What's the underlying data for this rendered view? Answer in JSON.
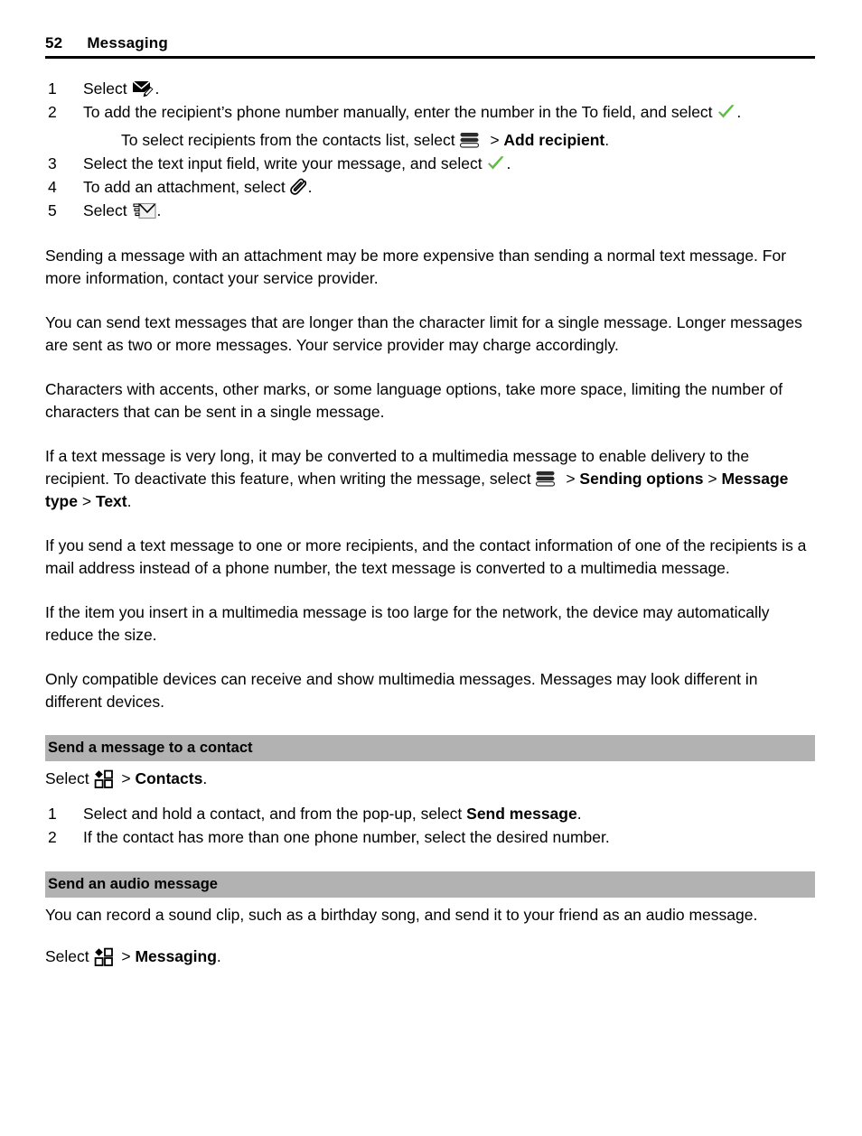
{
  "header": {
    "page_number": "52",
    "chapter": "Messaging"
  },
  "icons": {
    "new_message": "new-message-envelope-pencil-icon",
    "check": "green-check-icon",
    "menu": "options-menu-icon",
    "attachment": "paperclip-icon",
    "send": "send-message-envelope-icon",
    "app_grid": "applications-grid-icon"
  },
  "steps": [
    {
      "number": "1",
      "prefix": "Select ",
      "suffix": "."
    },
    {
      "number": "2",
      "prefix": "To add the recipient’s phone number manually, enter the number in the To field, and select ",
      "suffix": "."
    },
    {
      "number": "3",
      "prefix": "Select the text input field, write your message, and select ",
      "suffix": "."
    },
    {
      "number": "4",
      "prefix": "To add an attachment, select ",
      "suffix": "."
    },
    {
      "number": "5",
      "prefix": "Select ",
      "suffix": "."
    }
  ],
  "substep": {
    "prefix": "To select recipients from the contacts list, select ",
    "separator": " > ",
    "bold_target": "Add recipient",
    "suffix": "."
  },
  "paragraphs": {
    "p1": "Sending a message with an attachment may be more expensive than sending a normal text message. For more information, contact your service provider.",
    "p2": "You can send text messages that are longer than the character limit for a single message. Longer messages are sent as two or more messages. Your service provider may charge accordingly.",
    "p3": "Characters with accents, other marks, or some language options, take more space, limiting the number of characters that can be sent in a single message.",
    "p4_lead": "If a text message is very long, it may be converted to a multimedia message to enable delivery to the recipient. To deactivate this feature, when writing the message, select ",
    "p4_sep1": " > ",
    "p4_opt1": "Sending options",
    "p4_sep2": " > ",
    "p4_opt2": "Message type",
    "p4_sep3": " > ",
    "p4_opt3": "Text",
    "p4_end": ".",
    "p5": "If you send a text message to one or more recipients, and the contact information of one of the recipients is a mail address instead of a phone number, the text message is converted to a multimedia message.",
    "p6": "If the item you insert in a multimedia message is too large for the network, the device may automatically reduce the size.",
    "p7": "Only compatible devices can receive and show multimedia messages. Messages may look different in different devices."
  },
  "section_contact": {
    "heading": "Send a message to a contact",
    "select_prefix": "Select ",
    "select_sep": " > ",
    "select_target": "Contacts",
    "select_end": ".",
    "steps": [
      {
        "number": "1",
        "prefix": "Select and hold a contact, and from the pop-up, select ",
        "bold": "Send message",
        "suffix": "."
      },
      {
        "number": "2",
        "prefix": "If the contact has more than one phone number, select the desired number.",
        "bold": "",
        "suffix": ""
      }
    ]
  },
  "section_audio": {
    "heading": "Send an audio message",
    "intro": "You can record a sound clip, such as a birthday song, and send it to your friend as an audio message.",
    "select_prefix": "Select ",
    "select_sep": " > ",
    "select_target": "Messaging",
    "select_end": "."
  },
  "colors": {
    "heading_bar": "#b2b2b2",
    "check_green": "#5fbb46",
    "text": "#000000"
  }
}
